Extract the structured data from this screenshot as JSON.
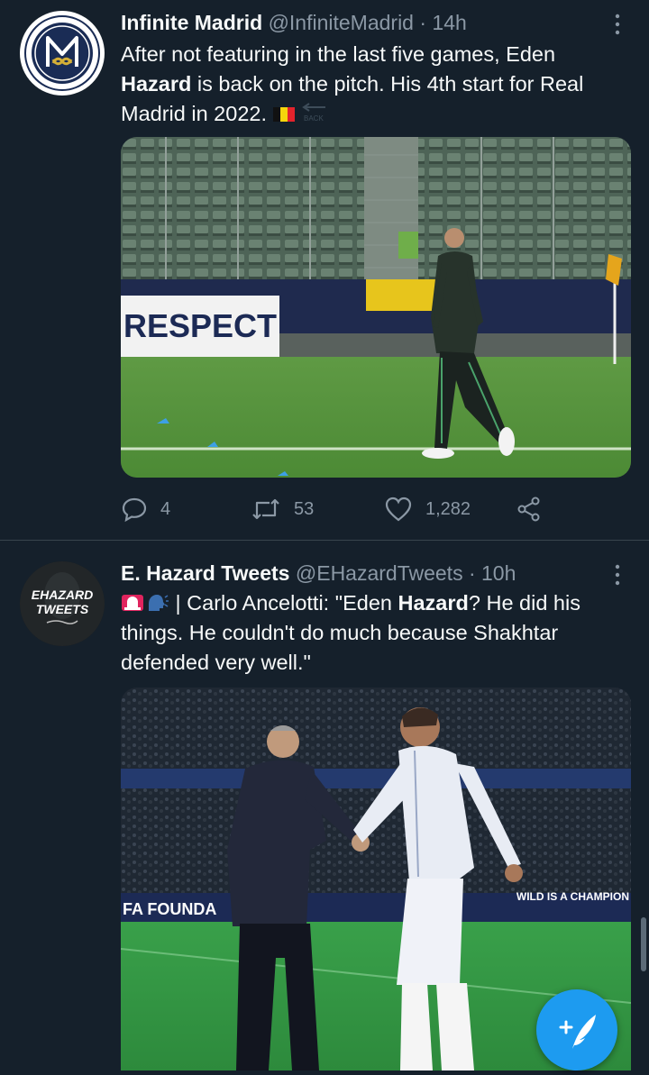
{
  "tweets": [
    {
      "author": "Infinite Madrid",
      "handle": "@InfiniteMadrid",
      "time": "· 14h",
      "text_pre": "After not featuring in the last five games, Eden ",
      "text_bold": "Hazard",
      "text_post": " is back on the pitch. His 4th start for Real Madrid in 2022. ",
      "stats": {
        "replies": "4",
        "retweets": "53",
        "likes": "1,282"
      },
      "media": {
        "banner_text": "RESPECT"
      }
    },
    {
      "author": "E. Hazard Tweets",
      "handle": "@EHazardTweets",
      "time": "· 10h",
      "text_prefix_sep": " | Carlo Ancelotti: \"Eden ",
      "text_bold": "Hazard",
      "text_post": "? He did his things. He couldn't do much because Shakhtar defended very well.\"",
      "avatar_text_1": "EHAZARD",
      "avatar_text_2": "TWEETS",
      "media": {
        "board_left": "FA FOUNDA",
        "board_right": "WILD IS A CHAMPION"
      }
    }
  ],
  "colors": {
    "background": "#15202b",
    "accent": "#1d9bf0",
    "muted": "#8b98a5",
    "text": "#f7f9f9"
  },
  "icons": [
    "more-icon",
    "reply-icon",
    "retweet-icon",
    "like-icon",
    "share-icon",
    "compose-icon",
    "belgium-flag-icon",
    "back-arrow-icon",
    "siren-icon",
    "speaking-head-icon"
  ]
}
